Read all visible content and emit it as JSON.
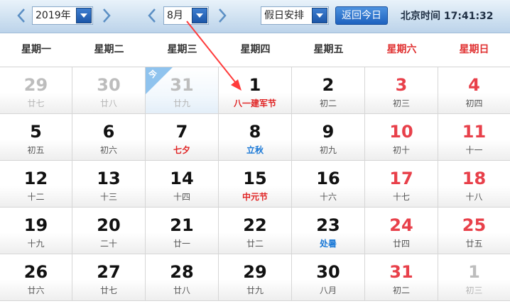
{
  "toolbar": {
    "year_value": "2019年",
    "month_value": "8月",
    "holiday_select": "假日安排",
    "back_today": "返回今日",
    "clock_label": "北京时间",
    "clock_time": "17:41:32"
  },
  "weekdays": [
    "星期一",
    "星期二",
    "星期三",
    "星期四",
    "星期五",
    "星期六",
    "星期日"
  ],
  "today_badge": "今",
  "colors": {
    "weekend": "#e8404a",
    "festival": "#e02424",
    "solar_term": "#1a78d6",
    "header_blue": "#1e62bf",
    "annotation": "#ff3b3b"
  },
  "weeks": [
    [
      {
        "day": "29",
        "sub": "廿七",
        "type": "other"
      },
      {
        "day": "30",
        "sub": "廿八",
        "type": "other"
      },
      {
        "day": "31",
        "sub": "廿九",
        "type": "other",
        "today": true
      },
      {
        "day": "1",
        "sub": "八一建军节",
        "type": "normal",
        "note": "festival"
      },
      {
        "day": "2",
        "sub": "初二",
        "type": "normal"
      },
      {
        "day": "3",
        "sub": "初三",
        "type": "weekend"
      },
      {
        "day": "4",
        "sub": "初四",
        "type": "weekend"
      }
    ],
    [
      {
        "day": "5",
        "sub": "初五",
        "type": "normal"
      },
      {
        "day": "6",
        "sub": "初六",
        "type": "normal"
      },
      {
        "day": "7",
        "sub": "七夕",
        "type": "normal",
        "note": "festival"
      },
      {
        "day": "8",
        "sub": "立秋",
        "type": "normal",
        "note": "solar"
      },
      {
        "day": "9",
        "sub": "初九",
        "type": "normal"
      },
      {
        "day": "10",
        "sub": "初十",
        "type": "weekend"
      },
      {
        "day": "11",
        "sub": "十一",
        "type": "weekend"
      }
    ],
    [
      {
        "day": "12",
        "sub": "十二",
        "type": "normal"
      },
      {
        "day": "13",
        "sub": "十三",
        "type": "normal"
      },
      {
        "day": "14",
        "sub": "十四",
        "type": "normal"
      },
      {
        "day": "15",
        "sub": "中元节",
        "type": "normal",
        "note": "festival"
      },
      {
        "day": "16",
        "sub": "十六",
        "type": "normal"
      },
      {
        "day": "17",
        "sub": "十七",
        "type": "weekend"
      },
      {
        "day": "18",
        "sub": "十八",
        "type": "weekend"
      }
    ],
    [
      {
        "day": "19",
        "sub": "十九",
        "type": "normal"
      },
      {
        "day": "20",
        "sub": "二十",
        "type": "normal"
      },
      {
        "day": "21",
        "sub": "廿一",
        "type": "normal"
      },
      {
        "day": "22",
        "sub": "廿二",
        "type": "normal"
      },
      {
        "day": "23",
        "sub": "处暑",
        "type": "normal",
        "note": "solar"
      },
      {
        "day": "24",
        "sub": "廿四",
        "type": "weekend"
      },
      {
        "day": "25",
        "sub": "廿五",
        "type": "weekend"
      }
    ],
    [
      {
        "day": "26",
        "sub": "廿六",
        "type": "normal"
      },
      {
        "day": "27",
        "sub": "廿七",
        "type": "normal"
      },
      {
        "day": "28",
        "sub": "廿八",
        "type": "normal"
      },
      {
        "day": "29",
        "sub": "廿九",
        "type": "normal"
      },
      {
        "day": "30",
        "sub": "八月",
        "type": "normal"
      },
      {
        "day": "31",
        "sub": "初二",
        "type": "weekend"
      },
      {
        "day": "1",
        "sub": "初三",
        "type": "other"
      }
    ]
  ]
}
